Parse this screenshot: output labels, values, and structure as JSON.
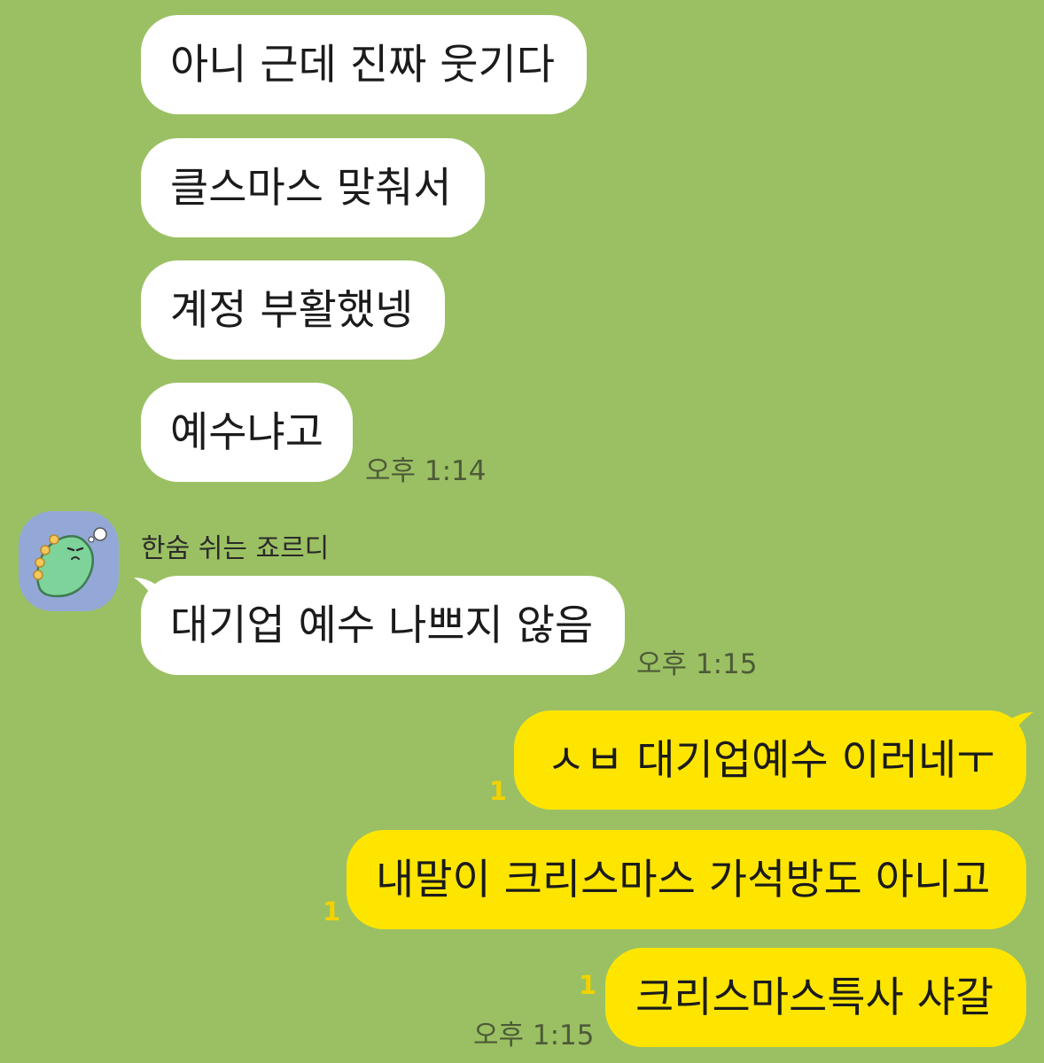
{
  "incoming": {
    "messages": [
      "아니 근데 진짜 웃기다",
      "클스마스 맞춰서",
      "계정 부활했넹",
      "예수냐고"
    ],
    "time_1": "오후 1:14",
    "sender_name": "한숨 쉬는 죠르디",
    "avatar_icon": "jordy-dinosaur-icon",
    "message_2": "대기업 예수 나쁘지 않음",
    "time_2": "오후 1:15"
  },
  "outgoing": {
    "messages": [
      "ㅅㅂ 대기업예수 이러네ㅜ",
      "내말이 크리스마스 가석방도 아니고",
      "크리스마스특사 샤갈"
    ],
    "unread_counts": [
      "1",
      "1",
      "1"
    ],
    "time": "오후 1:15"
  },
  "colors": {
    "background": "#9bc063",
    "incoming_bubble": "#ffffff",
    "outgoing_bubble": "#fee500",
    "unread": "#f2d200"
  }
}
